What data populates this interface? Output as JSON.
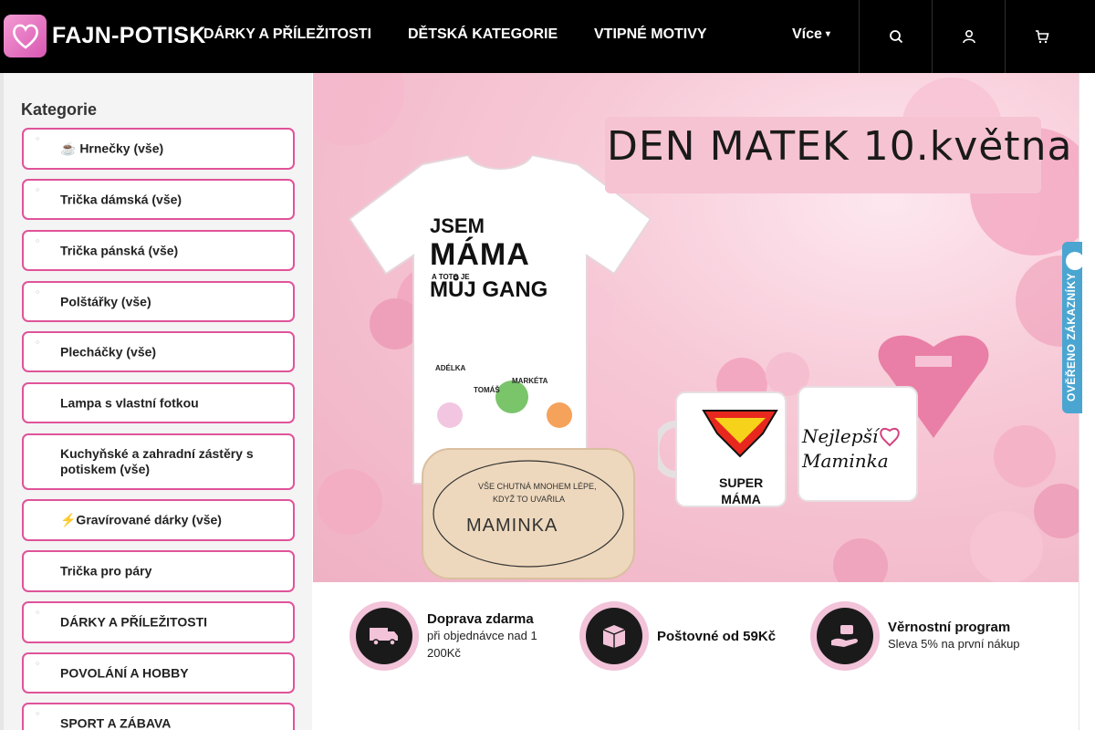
{
  "header": {
    "logo_text": "FAJN-POTISK",
    "nav": [
      "DÁRKY A PŘÍLEŽITOSTI",
      "DĚTSKÁ KATEGORIE",
      "VTIPNÉ MOTIVY"
    ],
    "more_label": "Více",
    "icons": [
      "search-icon",
      "user-icon",
      "cart-icon"
    ]
  },
  "sidebar": {
    "title": "Kategorie",
    "items": [
      "☕ Hrnečky (vše)",
      " Trička dámská (vše)",
      " Trička pánská (vše)",
      " Polštářky (vše)",
      " Plecháčky (vše)",
      " Lampa s vlastní fotkou",
      " Kuchyňské a zahradní zástěry s potiskem (vše)",
      "⚡Gravírované dárky (vše)",
      " Trička pro páry",
      "DÁRKY A PŘÍLEŽITOSTI",
      "POVOLÁNÍ A HOBBY",
      "SPORT A ZÁBAVA"
    ]
  },
  "hero": {
    "title": "DEN MATEK 10.května",
    "shirt": {
      "line1": "JSEM",
      "line2": "MÁMA",
      "line3": "A TOTO JE",
      "line4": "MŮJ GANG",
      "kids": [
        "ADÉLKA",
        "TOMÁŠ",
        "MARKÉTA"
      ]
    },
    "board": {
      "line1": "VŠE CHUTNÁ MNOHEM LÉPE,",
      "line2": "KDYŽ TO UVAŘILA",
      "name": "MAMINKA"
    },
    "mug_a": "SUPER MÁMA",
    "mug_b_line1": "Nejlepší",
    "mug_b_line2": "Maminka"
  },
  "benefits": [
    {
      "icon": "delivery-truck-icon",
      "title": "Doprava zdarma",
      "sub": "při objednávce nad 1 200Kč"
    },
    {
      "icon": "package-box-icon",
      "title": "Poštovné od 59Kč",
      "sub": ""
    },
    {
      "icon": "hand-coin-icon",
      "title": "Věrnostní program",
      "sub": "Sleva 5% na první nákup"
    }
  ],
  "verified_badge": "OVĚŘENO ZÁKAZNÍKY",
  "colors": {
    "header_bg": "#000000",
    "accent_pink": "#e0539a",
    "sidebar_bg": "#f4f4f4",
    "badge_blue": "#4aa6d1"
  }
}
